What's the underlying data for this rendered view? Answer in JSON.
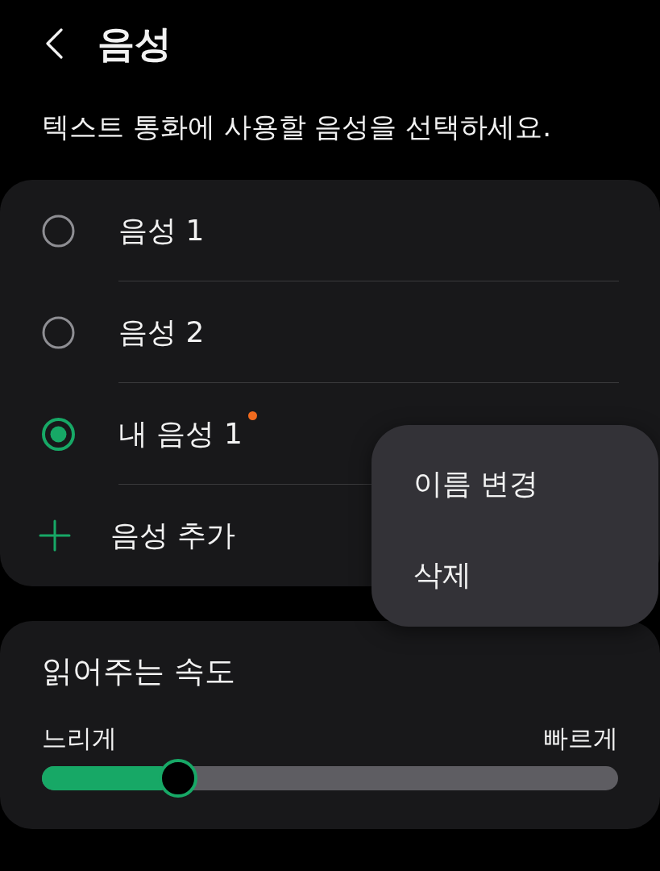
{
  "header": {
    "title": "음성"
  },
  "description": "텍스트 통화에 사용할 음성을 선택하세요.",
  "voices": [
    {
      "label": "음성 1",
      "selected": false,
      "dot": false
    },
    {
      "label": "음성 2",
      "selected": false,
      "dot": false
    },
    {
      "label": "내 음성 1",
      "selected": true,
      "dot": true
    }
  ],
  "add_voice": {
    "label": "음성 추가"
  },
  "context_menu": {
    "items": [
      {
        "label": "이름 변경"
      },
      {
        "label": "삭제"
      }
    ]
  },
  "speed": {
    "title": "읽어주는 속도",
    "min_label": "느리게",
    "max_label": "빠르게",
    "level": 0.236
  }
}
